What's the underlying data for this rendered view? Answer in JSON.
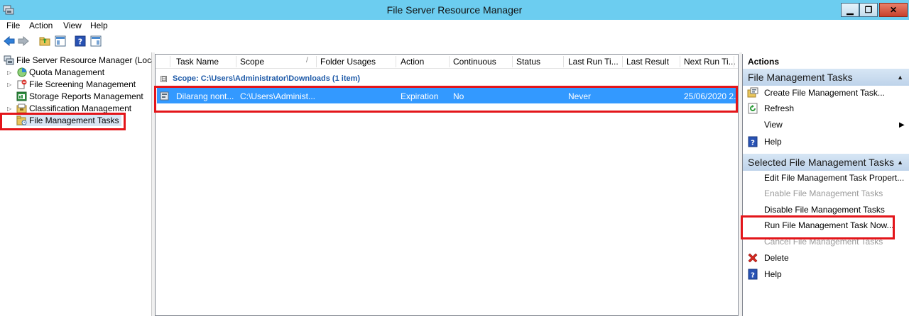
{
  "window": {
    "title": "File Server Resource Manager",
    "controls": {
      "minimize": "▁",
      "restore": "❐",
      "close": "✕"
    }
  },
  "menu": [
    "File",
    "Action",
    "View",
    "Help"
  ],
  "toolbar": {
    "icons": [
      "back-arrow-icon",
      "forward-arrow-icon",
      "up-folder-icon",
      "show-hide-tree-icon",
      "help-icon",
      "show-hide-action-pane-icon"
    ]
  },
  "tree": {
    "root": "File Server Resource Manager (Local)",
    "items": [
      {
        "label": "Quota Management",
        "icon": "quota-icon",
        "expandable": true
      },
      {
        "label": "File Screening Management",
        "icon": "file-screening-icon",
        "expandable": true
      },
      {
        "label": "Storage Reports Management",
        "icon": "storage-reports-icon",
        "expandable": false
      },
      {
        "label": "Classification Management",
        "icon": "classification-icon",
        "expandable": true
      },
      {
        "label": "File Management Tasks",
        "icon": "file-management-tasks-icon",
        "expandable": false,
        "selected": true
      }
    ]
  },
  "list": {
    "columns": [
      "Task Name",
      "Scope",
      "Folder Usages",
      "Action",
      "Continuous",
      "Status",
      "Last Run Ti...",
      "Last Result",
      "Next Run Ti..."
    ],
    "sort_indicator": "/",
    "group_collapse": "⊟",
    "group_header": "Scope: C:\\Users\\Administrator\\Downloads (1 item)",
    "rows": [
      {
        "task_name": "Dilarang nont...",
        "scope": "C:\\Users\\Administ...",
        "folder_usages": "",
        "action": "Expiration",
        "continuous": "No",
        "status": "",
        "last_run": "Never",
        "last_result": "",
        "next_run": "25/06/2020 2..."
      }
    ]
  },
  "actions": {
    "header": "Actions",
    "sections": [
      {
        "title": "File Management Tasks",
        "collapse": "▲",
        "items": [
          {
            "label": "Create File Management Task...",
            "icon": "create-task-icon",
            "enabled": true
          },
          {
            "label": "Refresh",
            "icon": "refresh-icon",
            "enabled": true
          },
          {
            "label": "View",
            "icon": "",
            "enabled": true,
            "submenu": "▶"
          },
          {
            "label": "Help",
            "icon": "help-icon",
            "enabled": true
          }
        ]
      },
      {
        "title": "Selected File Management Tasks",
        "collapse": "▲",
        "items": [
          {
            "label": "Edit File Management Task Propert...",
            "icon": "",
            "enabled": true
          },
          {
            "label": "Enable File Management Tasks",
            "icon": "",
            "enabled": false
          },
          {
            "label": "Disable File Management Tasks",
            "icon": "",
            "enabled": true
          },
          {
            "label": "Run File Management Task Now...",
            "icon": "",
            "enabled": true
          },
          {
            "label": "Cancel File Management Tasks",
            "icon": "",
            "enabled": false
          },
          {
            "label": "Delete",
            "icon": "delete-icon",
            "enabled": true
          },
          {
            "label": "Help",
            "icon": "help-icon",
            "enabled": true
          }
        ]
      }
    ]
  },
  "colors": {
    "titlebar": "#6ccdf0",
    "selection": "#3399ff",
    "group_header": "#1e5aa8",
    "highlight_box": "#e3151a",
    "section_header": "#c9dcef"
  }
}
